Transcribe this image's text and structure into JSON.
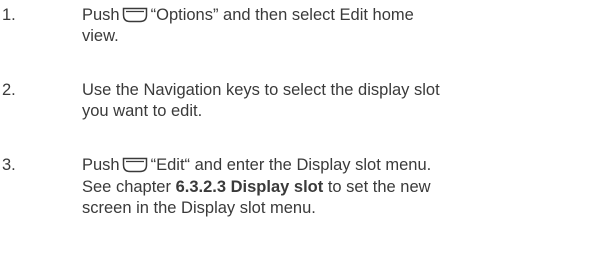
{
  "steps": [
    {
      "number": "1.",
      "line1_pre": "Push",
      "icon": "left-softkey-icon",
      "line1_post": "“Options” and then select Edit home",
      "line2": "view."
    },
    {
      "number": "2.",
      "line1": "Use the Navigation keys to select the display slot",
      "line2": "you want to edit."
    },
    {
      "number": "3.",
      "line1_pre": "Push",
      "icon": "right-softkey-icon",
      "line1_post": "“Edit“ and enter the Display slot menu.",
      "line2_pre": "See chapter",
      "line2_ref": "6.3.2.3 Display slot",
      "line2_post": "to set the new",
      "line3": "screen in the Display slot menu."
    }
  ]
}
